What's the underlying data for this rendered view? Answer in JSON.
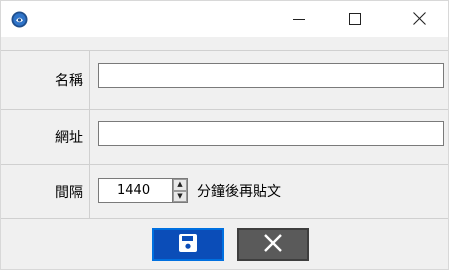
{
  "window": {
    "icon": "app-circle-icon",
    "controls": {
      "minimize_icon": "minimize-icon",
      "maximize_icon": "maximize-icon",
      "close_icon": "close-icon"
    }
  },
  "form": {
    "name": {
      "label": "名稱",
      "value": "",
      "placeholder": ""
    },
    "url": {
      "label": "網址",
      "value": "",
      "placeholder": ""
    },
    "interval": {
      "label": "間隔",
      "value": "1440",
      "suffix": "分鐘後再貼文"
    }
  },
  "actions": {
    "save_icon": "floppy-disk-icon",
    "cancel_icon": "x-icon"
  },
  "colors": {
    "save_button_bg": "#0b4db8",
    "cancel_button_bg": "#5a5a5a",
    "window_bg": "#f0f0f0",
    "title_bg": "#ffffff"
  }
}
